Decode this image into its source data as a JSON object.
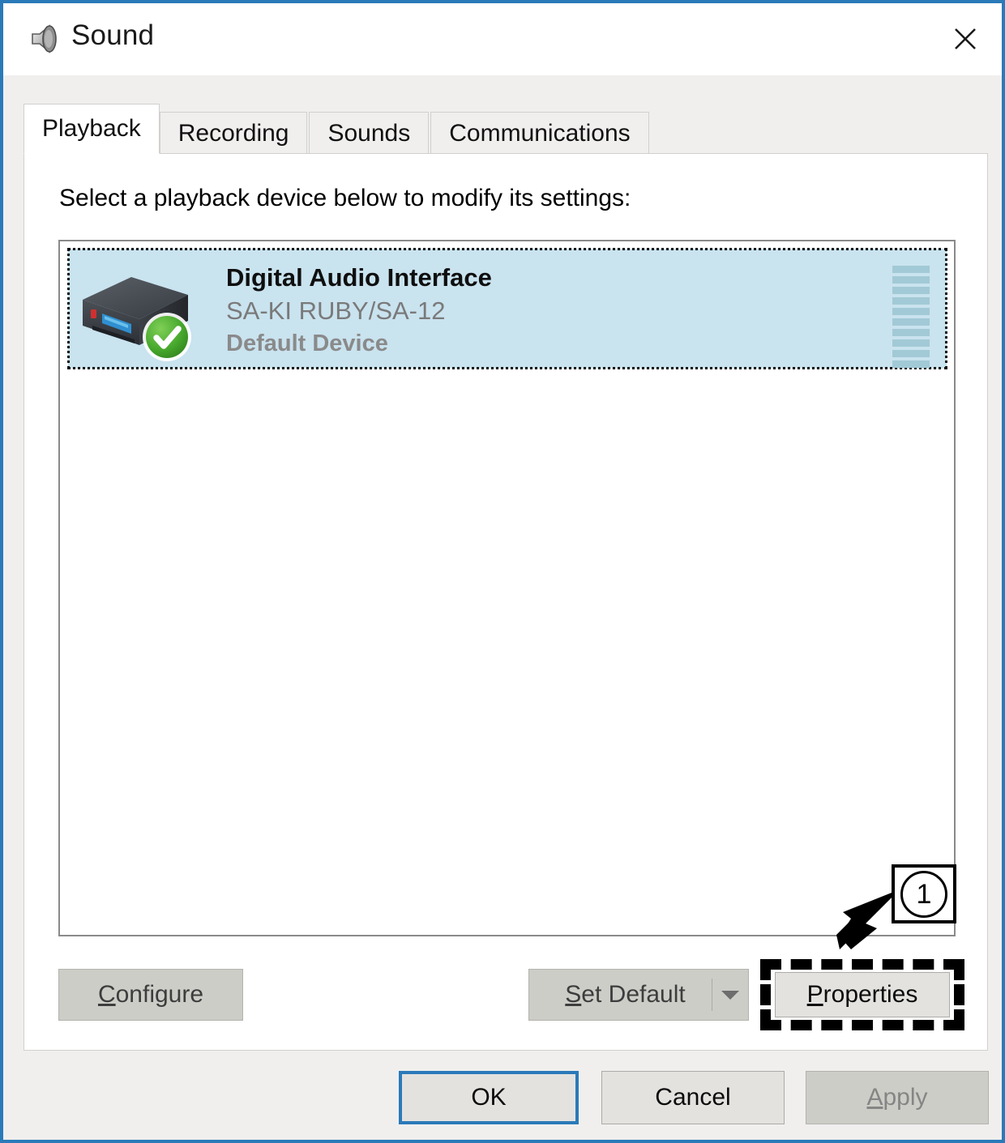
{
  "window": {
    "title": "Sound",
    "icon": "speaker-icon",
    "close_label": "✕",
    "border_color": "#2a7ab9"
  },
  "tabs": [
    {
      "label": "Playback",
      "active": true
    },
    {
      "label": "Recording",
      "active": false
    },
    {
      "label": "Sounds",
      "active": false
    },
    {
      "label": "Communications",
      "active": false
    }
  ],
  "playback": {
    "instruction": "Select a playback device below to modify its settings:",
    "devices": [
      {
        "name": "Digital Audio Interface",
        "model": "SA-KI RUBY/SA-12",
        "status": "Default Device",
        "selected": true,
        "default_badge": "check-badge",
        "meter_bars": 10,
        "meter_color": "#a2c9d6",
        "selection_color": "#c9e3ef"
      }
    ]
  },
  "action_buttons": {
    "configure": {
      "label": "Configure",
      "accel": "C",
      "enabled": false
    },
    "set_default": {
      "label": "Set Default",
      "accel": "S",
      "enabled": false,
      "has_dropdown": true
    },
    "properties": {
      "label": "Properties",
      "accel": "P",
      "enabled": true,
      "highlighted": true
    }
  },
  "footer_buttons": {
    "ok": {
      "label": "OK",
      "enabled": true,
      "focused": true
    },
    "cancel": {
      "label": "Cancel",
      "enabled": true,
      "focused": false
    },
    "apply": {
      "label": "Apply",
      "accel": "A",
      "enabled": false,
      "focused": false
    }
  },
  "annotation": {
    "callout_number": "1",
    "target": "Properties",
    "highlight_color": "#000000"
  }
}
